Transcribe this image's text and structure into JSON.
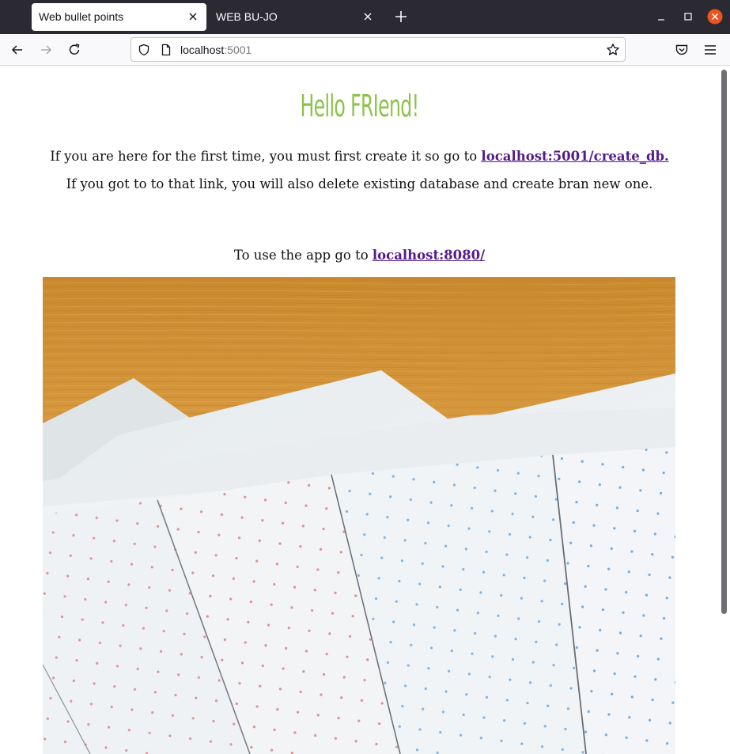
{
  "browser": {
    "tabs": [
      {
        "title": "Web bullet points",
        "active": true
      },
      {
        "title": "WEB BU-JO",
        "active": false
      }
    ],
    "url_host": "localhost",
    "url_port": ":5001",
    "icons": [
      "close-icon",
      "plus-icon",
      "minimize-icon",
      "maximize-icon",
      "window-close-icon",
      "back-arrow-icon",
      "forward-arrow-icon",
      "reload-icon",
      "shield-icon",
      "page-icon",
      "star-icon",
      "pocket-icon",
      "hamburger-menu-icon"
    ]
  },
  "page": {
    "heading": "Hello FRIend!",
    "intro_text": "If you are here for the first time, you must first create it so go to ",
    "create_db_link": "localhost:5001/create_db.",
    "warning_text": "If you got to to that link, you will also delete existing database and create bran new one.",
    "use_text": "To use the app go to ",
    "app_link": "localhost:8080/",
    "image_description_icon": "dotted-notebook-pages-photo"
  },
  "colors": {
    "heading": "#8bc34a",
    "link": "#551a8b",
    "tabbar": "#2b2a33",
    "close_window": "#e95420"
  }
}
